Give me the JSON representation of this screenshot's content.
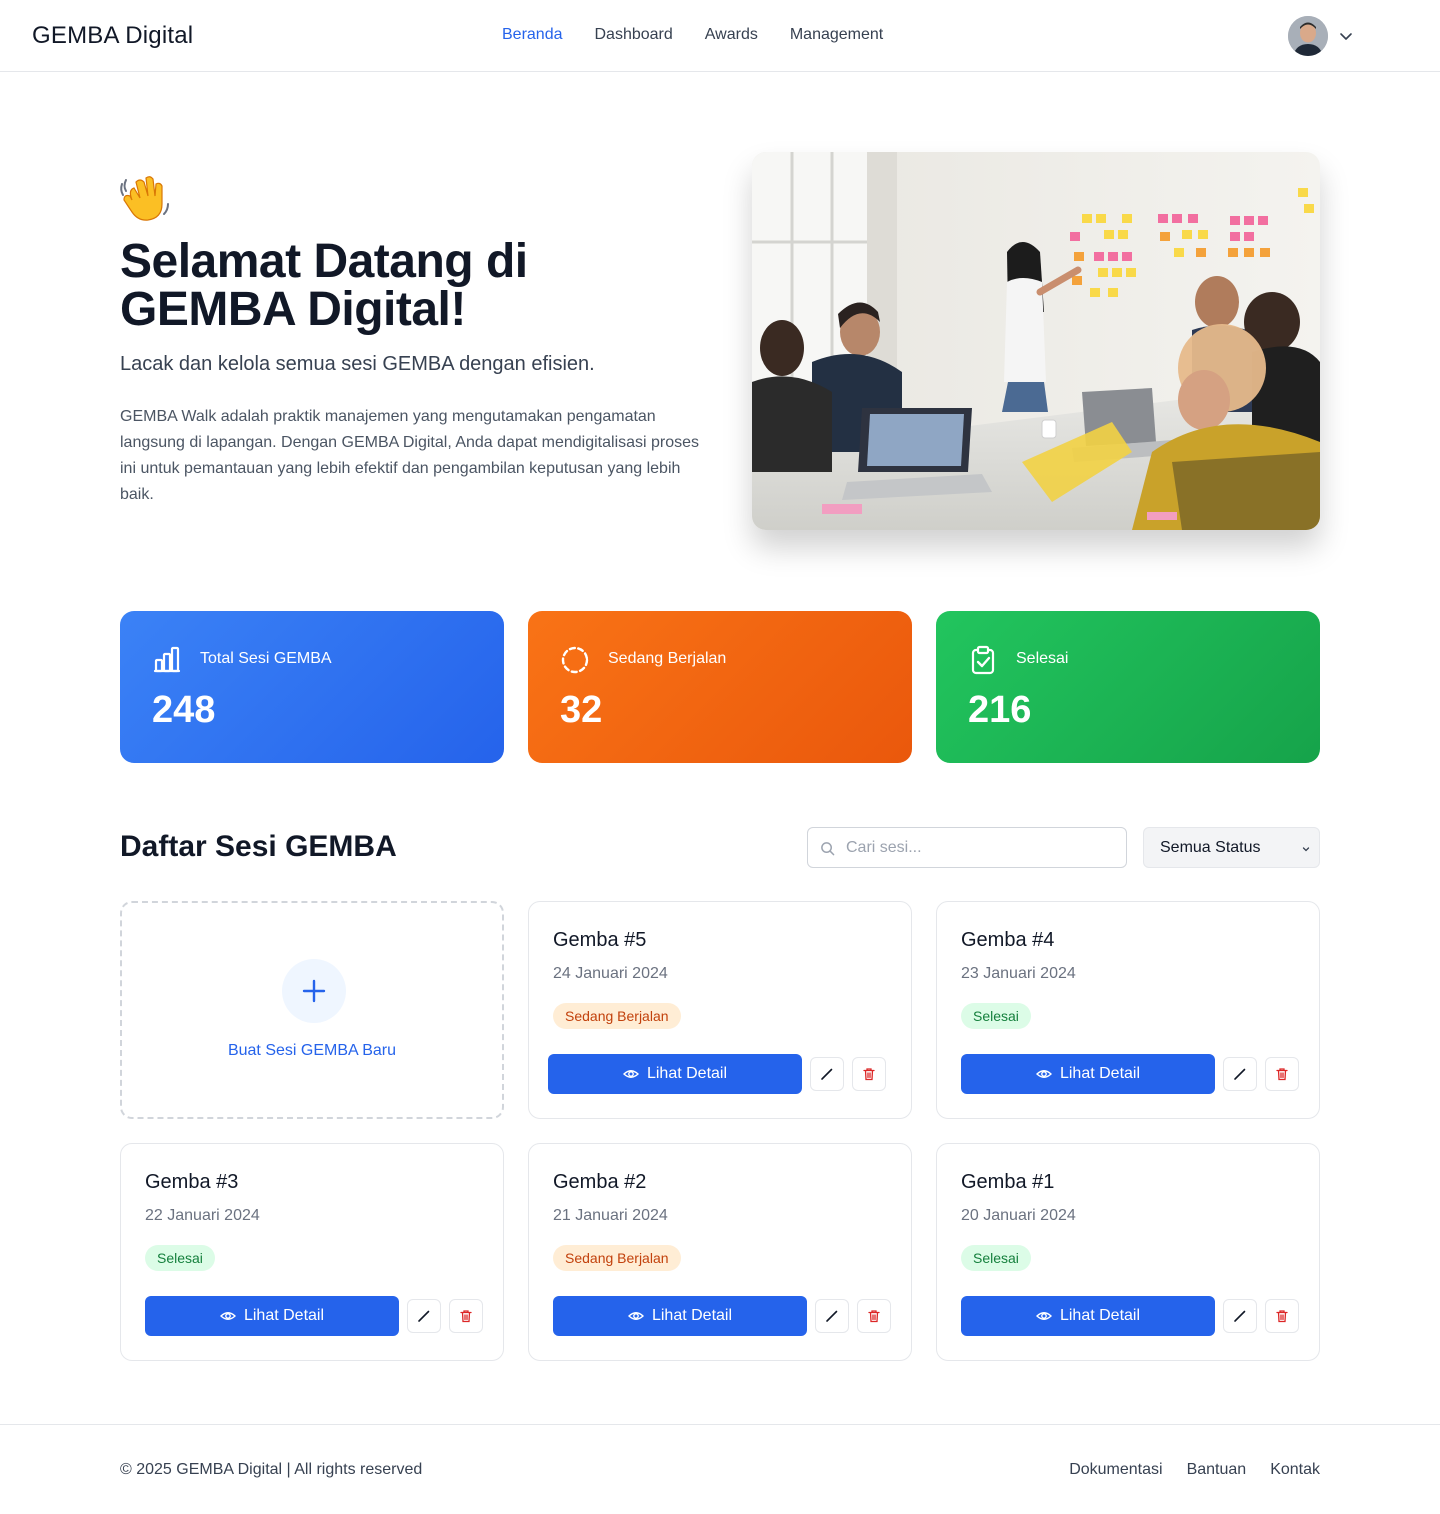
{
  "header": {
    "brand": "GEMBA Digital",
    "nav": [
      {
        "label": "Beranda",
        "active": true
      },
      {
        "label": "Dashboard",
        "active": false
      },
      {
        "label": "Awards",
        "active": false
      },
      {
        "label": "Management",
        "active": false
      }
    ],
    "user_icon": "avatar",
    "dropdown_icon": "chevron-down-icon"
  },
  "hero": {
    "emoji": "👋",
    "title": "Selamat Datang di GEMBA Digital!",
    "subtitle": "Lacak dan kelola semua sesi GEMBA dengan efisien.",
    "description": "GEMBA Walk adalah praktik manajemen yang mengutamakan pengamatan langsung di lapangan. Dengan GEMBA Digital, Anda dapat mendigitalisasi proses ini untuk pemantauan yang lebih efektif dan pengambilan keputusan yang lebih baik."
  },
  "stats": [
    {
      "label": "Total Sesi GEMBA",
      "value": "248",
      "icon": "bar-chart-icon",
      "color": "#2563eb"
    },
    {
      "label": "Sedang Berjalan",
      "value": "32",
      "icon": "loader-icon",
      "color": "#ea580c"
    },
    {
      "label": "Selesai",
      "value": "216",
      "icon": "clipboard-check-icon",
      "color": "#16a34a"
    }
  ],
  "list": {
    "title": "Daftar Sesi GEMBA",
    "search_placeholder": "Cari sesi...",
    "status_filter": "Semua Status",
    "new_label": "Buat Sesi GEMBA Baru",
    "detail_label": "Lihat Detail",
    "sessions": [
      {
        "title": "Gemba #5",
        "date": "24 Januari 2024",
        "status": "Sedang Berjalan"
      },
      {
        "title": "Gemba #4",
        "date": "23 Januari 2024",
        "status": "Selesai"
      },
      {
        "title": "Gemba #3",
        "date": "22 Januari 2024",
        "status": "Selesai"
      },
      {
        "title": "Gemba #2",
        "date": "21 Januari 2024",
        "status": "Sedang Berjalan"
      },
      {
        "title": "Gemba #1",
        "date": "20 Januari 2024",
        "status": "Selesai"
      }
    ]
  },
  "footer": {
    "copyright": "© 2025 GEMBA Digital | All rights reserved",
    "links": [
      "Dokumentasi",
      "Bantuan",
      "Kontak"
    ]
  }
}
